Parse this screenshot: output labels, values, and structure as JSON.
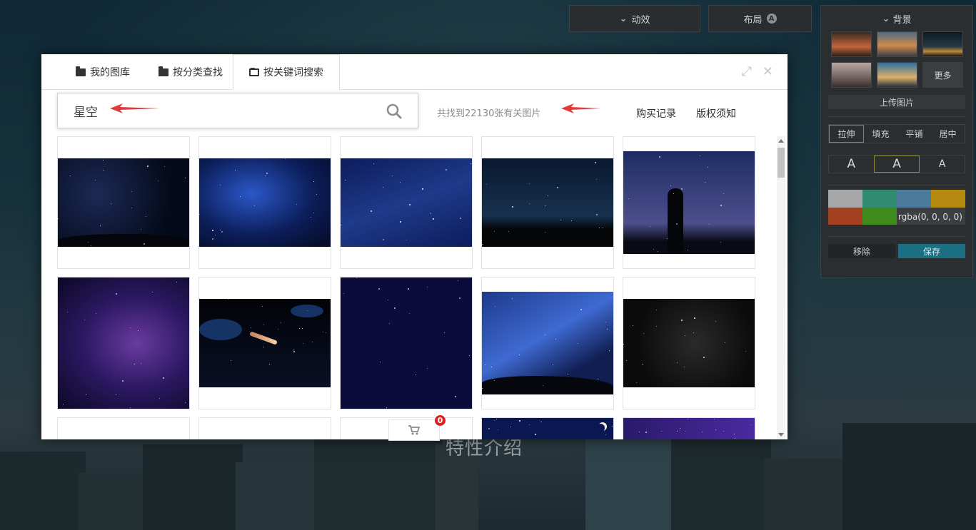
{
  "background": {
    "heading": "特性介绍"
  },
  "toolbar": {
    "animation_label": "动效",
    "layout_label": "布局",
    "layout_badge": "A"
  },
  "bg_panel": {
    "title": "背景",
    "more_label": "更多",
    "upload_label": "上传图片",
    "fill_modes": [
      "拉伸",
      "填充",
      "平铺",
      "居中"
    ],
    "active_fill_mode": "拉伸",
    "font_options": [
      "A",
      "A",
      "A"
    ],
    "swatch_colors": [
      "#a7a7a7",
      "#2f8a6f",
      "#4b7a9a",
      "#b58a11",
      "#a4401f",
      "#3f8a1d"
    ],
    "rgba_value": "rgba(0, 0, 0, 0)",
    "remove_label": "移除",
    "save_label": "保存"
  },
  "modal": {
    "tabs": [
      {
        "label": "我的图库"
      },
      {
        "label": "按分类查找"
      },
      {
        "label": "按关键词搜索"
      }
    ],
    "active_tab": "按关键词搜索",
    "search": {
      "value": "星空",
      "placeholder": ""
    },
    "result_text": "共找到22130张有关图片",
    "purchase_link": "购买记录",
    "copyright_link": "版权须知",
    "cart_count": "0"
  }
}
